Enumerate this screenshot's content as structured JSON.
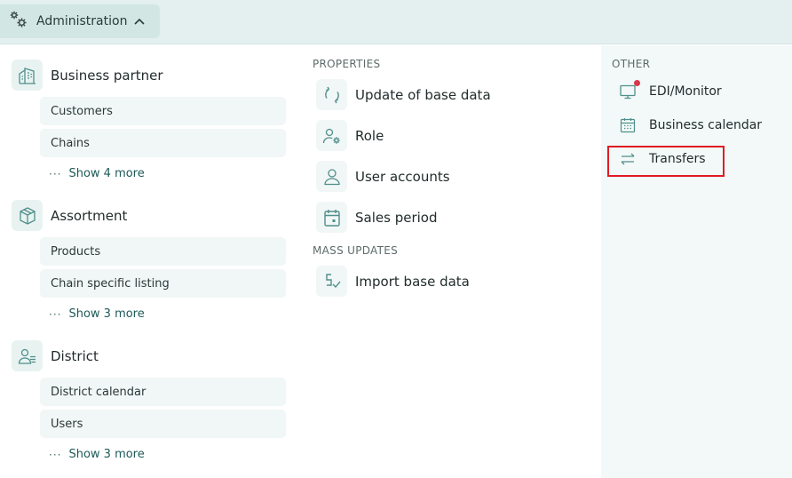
{
  "header": {
    "admin_label": "Administration",
    "admin_icon": "gears-icon",
    "chevron_icon": "chevron-up-icon"
  },
  "left": {
    "categories": [
      {
        "title": "Business partner",
        "icon": "building-icon",
        "items": [
          "Customers",
          "Chains"
        ],
        "more": "Show 4 more"
      },
      {
        "title": "Assortment",
        "icon": "box-icon",
        "items": [
          "Products",
          "Chain specific listing"
        ],
        "more": "Show 3 more"
      },
      {
        "title": "District",
        "icon": "users-icon",
        "items": [
          "District calendar",
          "Users"
        ],
        "more": "Show 3 more"
      }
    ],
    "more_dots": "···"
  },
  "middle": {
    "properties_heading": "PROPERTIES",
    "properties": [
      {
        "label": "Update of base data",
        "icon": "refresh-icon"
      },
      {
        "label": "Role",
        "icon": "user-gear-icon"
      },
      {
        "label": "User accounts",
        "icon": "user-icon"
      },
      {
        "label": "Sales period",
        "icon": "calendar-icon"
      }
    ],
    "mass_heading": "MASS UPDATES",
    "mass": [
      {
        "label": "Import base data",
        "icon": "import-check-icon"
      }
    ]
  },
  "right": {
    "heading": "OTHER",
    "items": [
      {
        "label": "EDI/Monitor",
        "icon": "monitor-icon",
        "notification": true
      },
      {
        "label": "Business calendar",
        "icon": "calendar-grid-icon"
      },
      {
        "label": "Transfers",
        "icon": "transfer-arrows-icon",
        "highlighted": true
      }
    ]
  },
  "colors": {
    "accent": "#1e5a58",
    "icon_stroke": "#4f8f8b",
    "highlight": "#e01b24",
    "notification": "#d9374b"
  }
}
